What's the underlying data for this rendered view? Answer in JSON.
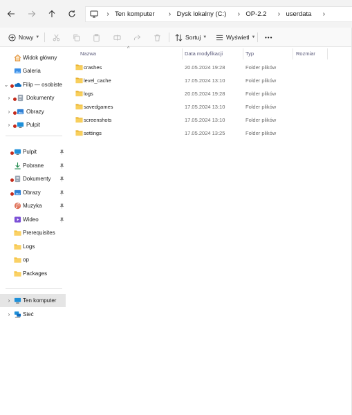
{
  "address_bar": {
    "crumbs": [
      "Ten komputer",
      "Dysk lokalny (C:)",
      "OP-2.2",
      "userdata"
    ]
  },
  "command_bar": {
    "new_label": "Nowy",
    "sort_label": "Sortuj",
    "view_label": "Wyświetl",
    "more_label": "•••"
  },
  "sidebar": {
    "top_items": [
      {
        "label": "Widok główny",
        "icon": "home-icon"
      },
      {
        "label": "Galeria",
        "icon": "gallery-icon"
      },
      {
        "label": "Filip — osobiste",
        "icon": "onedrive-icon"
      },
      {
        "label": "Dokumenty",
        "icon": "documents-icon"
      },
      {
        "label": "Obrazy",
        "icon": "pictures-icon"
      },
      {
        "label": "Pulpit",
        "icon": "desktop-icon"
      }
    ],
    "quick_access": [
      {
        "label": "Pulpit",
        "icon": "desktop-icon"
      },
      {
        "label": "Pobrane",
        "icon": "download-icon"
      },
      {
        "label": "Dokumenty",
        "icon": "documents-icon"
      },
      {
        "label": "Obrazy",
        "icon": "pictures-icon"
      },
      {
        "label": "Muzyka",
        "icon": "music-icon"
      },
      {
        "label": "Wideo",
        "icon": "video-icon"
      },
      {
        "label": "Prerequisites",
        "icon": "folder-icon"
      },
      {
        "label": "Logs",
        "icon": "folder-icon"
      },
      {
        "label": "op",
        "icon": "folder-icon"
      },
      {
        "label": "Packages",
        "icon": "folder-icon"
      }
    ],
    "bottom_items": [
      {
        "label": "Ten komputer",
        "icon": "computer-icon"
      },
      {
        "label": "Sieć",
        "icon": "network-icon"
      }
    ]
  },
  "columns": {
    "name": "Nazwa",
    "date": "Data modyfikacji",
    "type": "Typ",
    "size": "Rozmiar"
  },
  "files": [
    {
      "name": "crashes",
      "date": "20.05.2024 19:28",
      "type": "Folder plików"
    },
    {
      "name": "level_cache",
      "date": "17.05.2024 13:10",
      "type": "Folder plików"
    },
    {
      "name": "logs",
      "date": "20.05.2024 19:28",
      "type": "Folder plików"
    },
    {
      "name": "savedgames",
      "date": "17.05.2024 13:10",
      "type": "Folder plików"
    },
    {
      "name": "screenshots",
      "date": "17.05.2024 13:10",
      "type": "Folder plików"
    },
    {
      "name": "settings",
      "date": "17.05.2024 13:25",
      "type": "Folder plików"
    }
  ],
  "colors": {
    "folder": "#f5c342",
    "accent": "#0067c0",
    "sync_error": "#c42b1c",
    "selected_bg": "#e5e5e5"
  }
}
